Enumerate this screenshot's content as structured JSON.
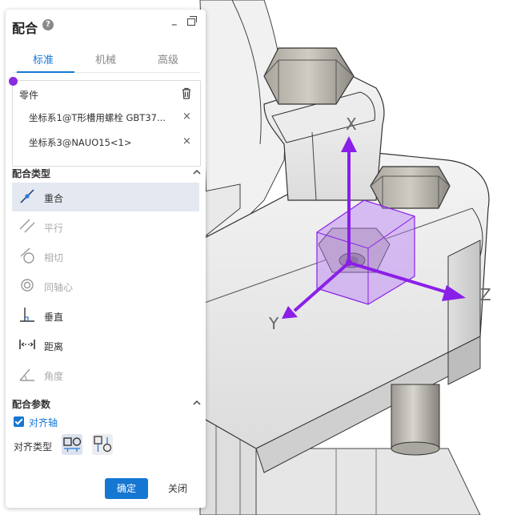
{
  "panel": {
    "title": "配合",
    "tabs": [
      {
        "label": "标准",
        "active": true
      },
      {
        "label": "机械",
        "active": false
      },
      {
        "label": "高级",
        "active": false
      }
    ],
    "parts": {
      "title": "零件",
      "items": [
        {
          "label": "坐标系1@T形槽用螺栓 GBT37..."
        },
        {
          "label": "坐标系3@NAUO15<1>"
        }
      ],
      "remove_glyph": "×"
    },
    "mate_types": {
      "title": "配合类型",
      "items": [
        {
          "label": "重合",
          "icon": "coincident-icon",
          "selected": true,
          "enabled": true
        },
        {
          "label": "平行",
          "icon": "parallel-icon",
          "selected": false,
          "enabled": false
        },
        {
          "label": "相切",
          "icon": "tangent-icon",
          "selected": false,
          "enabled": false
        },
        {
          "label": "同轴心",
          "icon": "concentric-icon",
          "selected": false,
          "enabled": false
        },
        {
          "label": "垂直",
          "icon": "perpendicular-icon",
          "selected": false,
          "enabled": true
        },
        {
          "label": "距离",
          "icon": "distance-icon",
          "selected": false,
          "enabled": true
        },
        {
          "label": "角度",
          "icon": "angle-icon",
          "selected": false,
          "enabled": false
        }
      ]
    },
    "mate_params": {
      "title": "配合参数",
      "align_axis_label": "对齐轴",
      "align_axis_checked": true,
      "align_type_label": "对齐类型"
    },
    "ok_label": "确定",
    "close_label": "关闭"
  },
  "viewport": {
    "axis_labels": {
      "x": "X",
      "y": "Y",
      "z": "Z"
    }
  },
  "colors": {
    "accent": "#1677d2",
    "triad": "#8a1fe8",
    "selection_box": "#b57cf5"
  }
}
